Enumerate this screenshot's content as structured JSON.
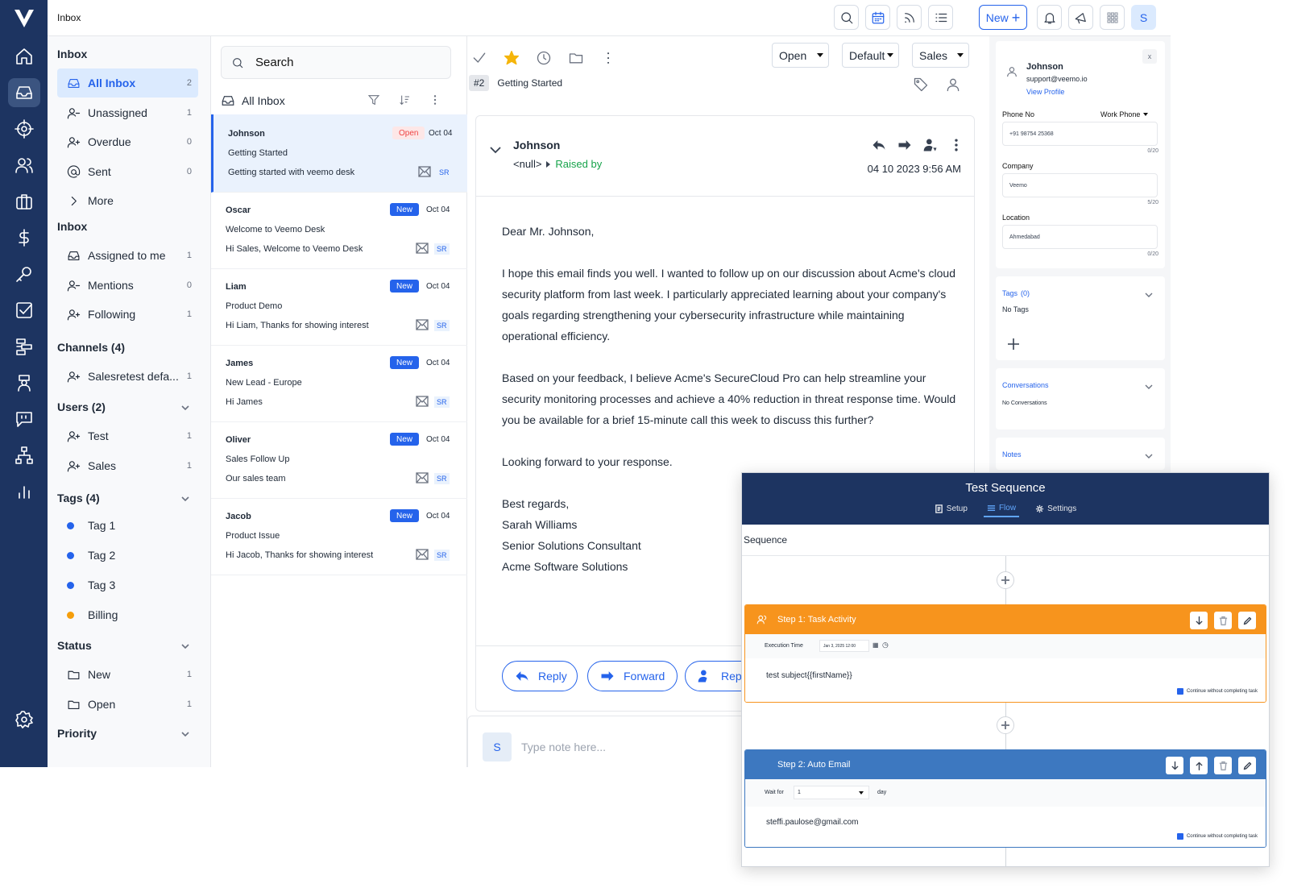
{
  "topbar": {
    "title": "Inbox",
    "new_label": "New",
    "avatar": "S"
  },
  "sidebar": {
    "inbox_heading": "Inbox",
    "primary": [
      {
        "label": "All Inbox",
        "count": "2",
        "icon": "inbox-icon"
      },
      {
        "label": "Unassigned",
        "count": "1",
        "icon": "user-minus-icon"
      },
      {
        "label": "Overdue",
        "count": "0",
        "icon": "user-plus-icon"
      },
      {
        "label": "Sent",
        "count": "0",
        "icon": "at-icon"
      },
      {
        "label": "More",
        "count": "",
        "icon": "chevron-right-icon"
      }
    ],
    "inbox2_heading": "Inbox",
    "secondary": [
      {
        "label": "Assigned to me",
        "count": "1"
      },
      {
        "label": "Mentions",
        "count": "0"
      },
      {
        "label": "Following",
        "count": "1"
      }
    ],
    "channels_heading": "Channels (4)",
    "channels": [
      {
        "label": "Salesretest defa...",
        "count": "1"
      }
    ],
    "users_heading": "Users (2)",
    "users": [
      {
        "label": "Test",
        "count": "1"
      },
      {
        "label": "Sales",
        "count": "1"
      }
    ],
    "tags_heading": "Tags (4)",
    "tags": [
      {
        "label": "Tag 1",
        "color": "#2563eb"
      },
      {
        "label": "Tag 2",
        "color": "#2563eb"
      },
      {
        "label": "Tag 3",
        "color": "#2563eb"
      },
      {
        "label": "Billing",
        "color": "#f59e0b"
      }
    ],
    "status_heading": "Status",
    "status": [
      {
        "label": "New",
        "count": "1"
      },
      {
        "label": "Open",
        "count": "1"
      }
    ],
    "priority_heading": "Priority"
  },
  "convlist": {
    "search_placeholder": "Search",
    "heading": "All Inbox",
    "items": [
      {
        "name": "Johnson",
        "subject": "Getting Started",
        "preview": "Getting started with veemo desk",
        "badge": "Open",
        "date": "Oct 04",
        "tag": "SR"
      },
      {
        "name": "Oscar",
        "subject": "Welcome to Veemo Desk",
        "preview": "Hi Sales, Welcome to Veemo Desk",
        "badge": "New",
        "date": "Oct 04",
        "tag": "SR"
      },
      {
        "name": "Liam",
        "subject": "Product Demo",
        "preview": "Hi Liam, Thanks for showing interest",
        "badge": "New",
        "date": "Oct 04",
        "tag": "SR"
      },
      {
        "name": "James",
        "subject": "New Lead - Europe",
        "preview": "Hi James",
        "badge": "New",
        "date": "Oct 04",
        "tag": "SR"
      },
      {
        "name": "Oliver",
        "subject": "Sales Follow Up",
        "preview": "Our sales team",
        "badge": "New",
        "date": "Oct 04",
        "tag": "SR"
      },
      {
        "name": "Jacob",
        "subject": "Product Issue",
        "preview": "Hi Jacob, Thanks for showing interest",
        "badge": "New",
        "date": "Oct 04",
        "tag": "SR"
      }
    ]
  },
  "main": {
    "status_select": "Open",
    "view_select": "Default",
    "team_select": "Sales",
    "ticket_number": "#2",
    "ticket_title": "Getting Started",
    "sender": "Johnson",
    "sender_email": "<null>",
    "raised_by": "Raised by",
    "timestamp": "04 10 2023 9:56 AM",
    "body": [
      "Dear Mr. Johnson,",
      "I hope this email finds you well. I wanted to follow up on our discussion about Acme's cloud security platform from last week. I particularly appreciated learning about your company's goals regarding strengthening your cybersecurity infrastructure while maintaining operational efficiency.",
      "Based on your feedback, I believe Acme's SecureCloud Pro can help streamline your security monitoring processes and achieve a 40% reduction in threat response time. Would you be available for a brief 15-minute call this week to discuss this further?",
      "Looking forward to your response."
    ],
    "signature": [
      "Best regards,",
      "Sarah Williams",
      "Senior Solutions Consultant",
      "Acme Software Solutions"
    ],
    "reply_label": "Reply",
    "forward_label": "Forward",
    "third_label": "Rep",
    "note_avatar": "S",
    "note_placeholder": "Type note here..."
  },
  "contact": {
    "name": "Johnson",
    "email": "support@veemo.io",
    "view_profile": "View Profile",
    "close": "x",
    "phone_label": "Phone No",
    "phone_type": "Work Phone",
    "phone_value": "+91 98754 25368",
    "phone_count": "0/20",
    "company_label": "Company",
    "company_value": "Veemo",
    "company_count": "5/20",
    "location_label": "Location",
    "location_value": "Ahmedabad",
    "location_count": "0/20",
    "tags_title": "Tags",
    "tags_count": "(0)",
    "no_tags": "No Tags",
    "conversations_title": "Conversations",
    "no_conversations": "No Conversations",
    "notes_title": "Notes"
  },
  "sequence": {
    "title": "Test Sequence",
    "tabs": [
      {
        "label": "Setup"
      },
      {
        "label": "Flow"
      },
      {
        "label": "Settings"
      }
    ],
    "section_label": "Sequence",
    "step1": {
      "title": "Step 1: Task Activity",
      "exec_label": "Execution Time",
      "exec_value": "Jan 3, 2025 12:00",
      "subject": "test subject{{firstName}}",
      "continue_label": "Continue without completing task",
      "color": "#f7941d"
    },
    "step2": {
      "title": "Step 2: Auto Email",
      "wait_label": "Wait for",
      "wait_value": "1",
      "wait_unit": "day",
      "email": "steffi.paulose@gmail.com",
      "continue_label": "Continue without completing task",
      "color": "#3d78c0"
    }
  }
}
